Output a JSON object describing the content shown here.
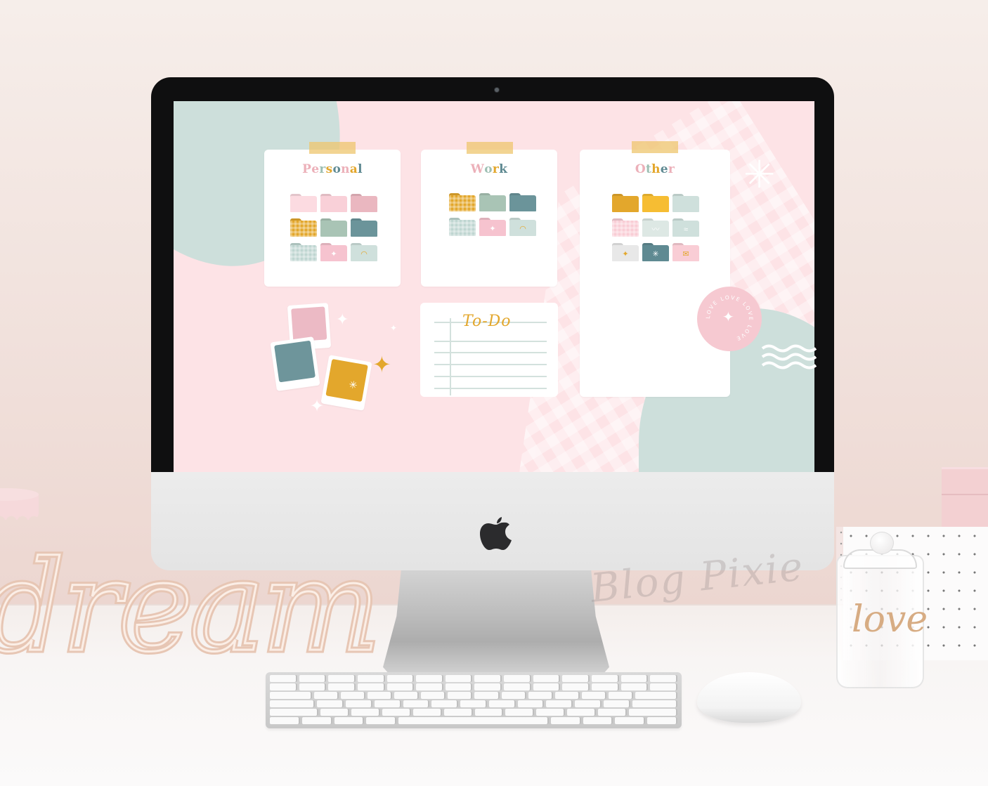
{
  "desktop": {
    "cards": [
      {
        "title": "Personal",
        "title_letters": [
          {
            "ch": "P",
            "color": "#ecb0b9"
          },
          {
            "ch": "e",
            "color": "#ecb0b9"
          },
          {
            "ch": "r",
            "color": "#9dbfb3"
          },
          {
            "ch": "s",
            "color": "#e3a72c"
          },
          {
            "ch": "o",
            "color": "#5f8a92"
          },
          {
            "ch": "n",
            "color": "#ecb0b9"
          },
          {
            "ch": "a",
            "color": "#e3a72c"
          },
          {
            "ch": "l",
            "color": "#5f8a92"
          }
        ],
        "folders": [
          {
            "name": "light-pink-folder",
            "color": "#fcdbe1",
            "pattern": "plain",
            "deco": ""
          },
          {
            "name": "pink-folder",
            "color": "#f9d0d8",
            "pattern": "plain",
            "deco": ""
          },
          {
            "name": "rose-folder",
            "color": "#eab7c0",
            "pattern": "plain",
            "deco": ""
          },
          {
            "name": "mustard-gingham-folder",
            "color": "#e3a72c",
            "pattern": "gingham",
            "deco": ""
          },
          {
            "name": "sage-folder",
            "color": "#a9c4b5",
            "pattern": "plain",
            "deco": ""
          },
          {
            "name": "teal-folder",
            "color": "#6b949a",
            "pattern": "plain",
            "deco": ""
          },
          {
            "name": "mint-gingham-folder",
            "color": "#bfd6d1",
            "pattern": "gingham",
            "deco": ""
          },
          {
            "name": "sparkle-folder",
            "color": "#f6c3cf",
            "pattern": "plain",
            "deco": "✦"
          },
          {
            "name": "rainbow-folder",
            "color": "#cfe0dc",
            "pattern": "plain",
            "deco": "◠"
          }
        ]
      },
      {
        "title": "Work",
        "title_letters": [
          {
            "ch": "W",
            "color": "#ecb0b9"
          },
          {
            "ch": "o",
            "color": "#9dbfb3"
          },
          {
            "ch": "r",
            "color": "#e3a72c"
          },
          {
            "ch": "k",
            "color": "#5f8a92"
          }
        ],
        "folders": [
          {
            "name": "mustard-gingham-folder",
            "color": "#e3a72c",
            "pattern": "gingham",
            "deco": ""
          },
          {
            "name": "sage-folder",
            "color": "#a9c4b5",
            "pattern": "plain",
            "deco": ""
          },
          {
            "name": "teal-folder",
            "color": "#6b949a",
            "pattern": "plain",
            "deco": ""
          },
          {
            "name": "mint-gingham-folder",
            "color": "#bfd6d1",
            "pattern": "gingham",
            "deco": ""
          },
          {
            "name": "sparkle-folder",
            "color": "#f6c3cf",
            "pattern": "plain",
            "deco": "✦"
          },
          {
            "name": "rainbow-folder",
            "color": "#cfe0dc",
            "pattern": "plain",
            "deco": "◠"
          }
        ]
      },
      {
        "title": "Other",
        "title_letters": [
          {
            "ch": "O",
            "color": "#ecb0b9"
          },
          {
            "ch": "t",
            "color": "#9dbfb3"
          },
          {
            "ch": "h",
            "color": "#e3a72c"
          },
          {
            "ch": "e",
            "color": "#5f8a92"
          },
          {
            "ch": "r",
            "color": "#ecb0b9"
          }
        ],
        "folders": [
          {
            "name": "mustard-folder",
            "color": "#e3a72c",
            "pattern": "plain",
            "deco": ""
          },
          {
            "name": "yellow-folder",
            "color": "#f6bd33",
            "pattern": "plain",
            "deco": ""
          },
          {
            "name": "mint-folder",
            "color": "#cfe0dc",
            "pattern": "plain",
            "deco": ""
          },
          {
            "name": "pink-gingham-folder",
            "color": "#f9cdd5",
            "pattern": "gingham",
            "deco": ""
          },
          {
            "name": "wave-stripe-folder",
            "color": "#dde8e4",
            "pattern": "plain",
            "deco": "〰"
          },
          {
            "name": "waves-folder",
            "color": "#cfe0dc",
            "pattern": "plain",
            "deco": "≈"
          },
          {
            "name": "star-folder",
            "color": "#e8e8e8",
            "pattern": "plain",
            "deco": "✦"
          },
          {
            "name": "burst-folder",
            "color": "#5f8a92",
            "pattern": "plain",
            "deco": "✳"
          },
          {
            "name": "love-letter-folder",
            "color": "#f9cdd5",
            "pattern": "plain",
            "deco": "✉"
          }
        ]
      }
    ],
    "todo": {
      "title": "To-Do"
    },
    "love_stamp": {
      "text": "LOVE LOVE LOVE LOVE ",
      "star": "✦"
    },
    "palette_swatches": [
      "#ecbac5",
      "#6e959b",
      "#e3a72c"
    ],
    "colors": {
      "screen_bg": "#fde3e6",
      "sage": "#cddfdb",
      "white": "#ffffff",
      "gold": "#e3a72c"
    }
  },
  "scene": {
    "decor_word": "dream",
    "jar_label": "love",
    "watermark": "Blog Pixie"
  }
}
